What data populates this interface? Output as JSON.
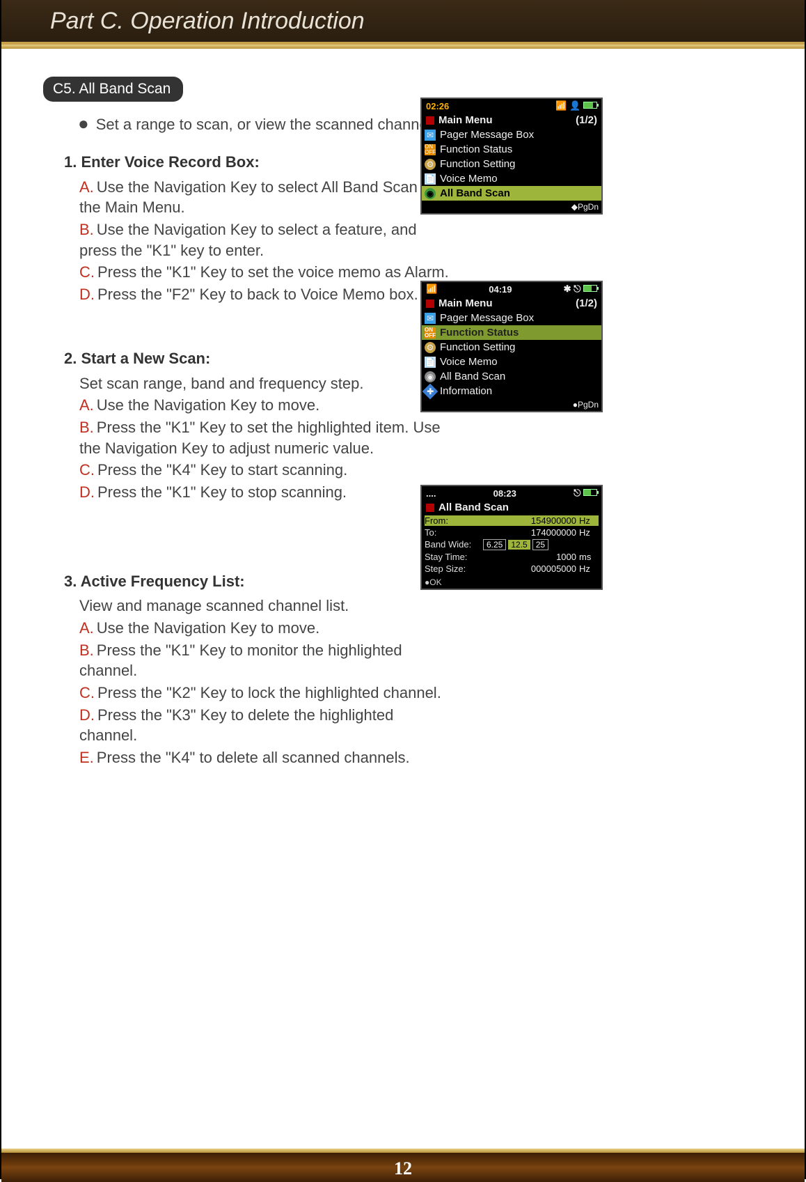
{
  "header": {
    "title": "Part C. Operation Introduction"
  },
  "section": {
    "tag": "C5. All Band Scan"
  },
  "intro": "Set a range to scan, or view the scanned channel list.",
  "steps": [
    {
      "num": "1.",
      "title": "Enter Voice Record Box:",
      "desc": "",
      "items": [
        {
          "l": "A.",
          "t": "Use the Navigation Key to select All Band Scan in the Main Menu."
        },
        {
          "l": "B.",
          "t": "Use the Navigation Key to select a feature, and press the \"K1\" key to enter."
        },
        {
          "l": "C.",
          "t": "Press the \"K1\" Key to set the voice memo as Alarm."
        },
        {
          "l": "D.",
          "t": "Press the \"F2\" Key to back to Voice Memo box."
        }
      ]
    },
    {
      "num": "2.",
      "title": "Start a New Scan:",
      "desc": "Set scan range, band and frequency step.",
      "items": [
        {
          "l": "A.",
          "t": "Use the Navigation Key to move."
        },
        {
          "l": "B.",
          "t": "Press the \"K1\" Key to set the highlighted item. Use the Navigation Key to adjust numeric value."
        },
        {
          "l": "C.",
          "t": "Press the \"K4\" Key to start scanning."
        },
        {
          "l": "D.",
          "t": "Press the \"K1\" Key to stop scanning."
        }
      ]
    },
    {
      "num": "3.",
      "title": "Active Frequency List:",
      "desc": "View and manage scanned channel list.",
      "items": [
        {
          "l": "A.",
          "t": "Use the Navigation Key to move."
        },
        {
          "l": "B.",
          "t": "Press  the \"K1\" Key to monitor the highlighted channel."
        },
        {
          "l": "C.",
          "t": "Press the \"K2\" Key to lock the highlighted channel."
        },
        {
          "l": "D.",
          "t": "Press the \"K3\" Key to delete the highlighted channel."
        },
        {
          "l": "E.",
          "t": "Press the \"K4\" to delete all scanned channels."
        }
      ]
    }
  ],
  "shot1": {
    "time": "02:26",
    "title": "Main Menu",
    "page": "(1/2)",
    "rows": [
      {
        "ico": "blue",
        "label": "Pager Message Box"
      },
      {
        "ico": "orange",
        "label": "Function Status"
      },
      {
        "ico": "gear",
        "label": "Function Setting"
      },
      {
        "ico": "doc",
        "label": "Voice Memo"
      },
      {
        "ico": "green",
        "label": "All Band Scan",
        "sel": true
      }
    ],
    "foot": "◆PgDn"
  },
  "shot2": {
    "time": "04:19",
    "title": "Main Menu",
    "page": "(1/2)",
    "rows": [
      {
        "ico": "blue",
        "label": "Pager Message Box"
      },
      {
        "ico": "orange",
        "label": "Function Status",
        "sel": true
      },
      {
        "ico": "gear",
        "label": "Function Setting"
      },
      {
        "ico": "doc",
        "label": "Voice Memo"
      },
      {
        "ico": "gray",
        "label": "All Band Scan"
      },
      {
        "ico": "info",
        "label": "Information"
      }
    ],
    "foot": "●PgDn"
  },
  "shot3": {
    "time": "08:23",
    "title": "All Band Scan",
    "rows": [
      {
        "lab": "From:",
        "val": "154900000",
        "unit": "Hz",
        "hi": true
      },
      {
        "lab": "To:",
        "val": "174000000",
        "unit": "Hz"
      },
      {
        "lab": "Band Wide:",
        "opts": [
          "6.25",
          "12.5",
          "25"
        ],
        "selIdx": 1
      },
      {
        "lab": "Stay Time:",
        "val": "1000",
        "unit": "ms"
      },
      {
        "lab": "Step Size:",
        "val": "000005000",
        "unit": "Hz"
      }
    ],
    "ok": "●OK"
  },
  "pagenum": "12"
}
